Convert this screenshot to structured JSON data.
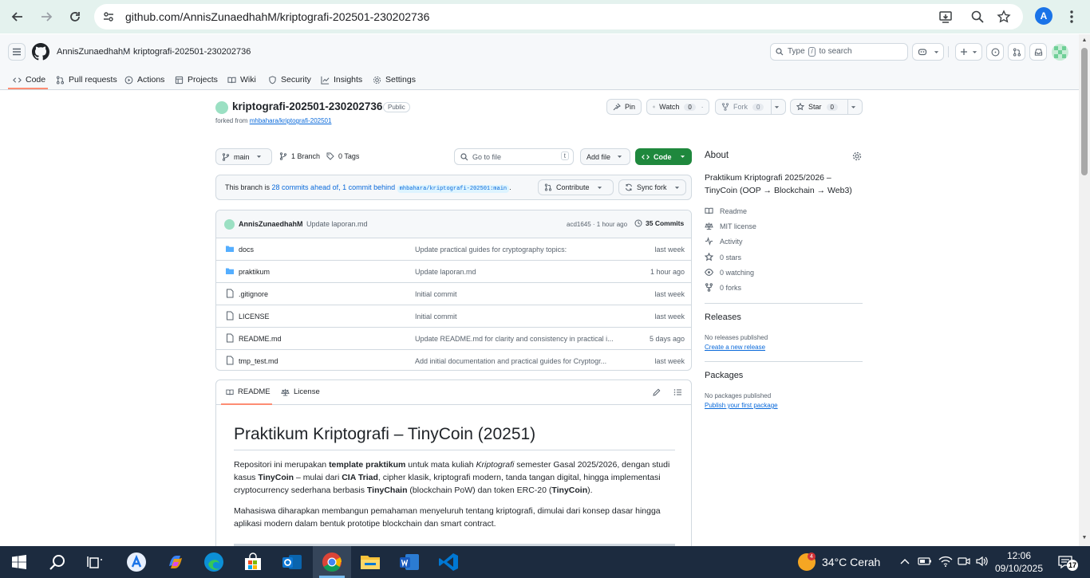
{
  "browser": {
    "url": "github.com/AnnisZunaedhahM/kriptografi-202501-230202736",
    "profile_initial": "A"
  },
  "header": {
    "owner": "AnnisZunaedhahM",
    "separator": "/",
    "repo": "kriptografi-202501-230202736",
    "search_prefix": "Type",
    "search_key": "/",
    "search_suffix": "to search"
  },
  "tabs": [
    {
      "label": "Code",
      "icon": "code-icon"
    },
    {
      "label": "Pull requests",
      "icon": "git-pull-request-icon"
    },
    {
      "label": "Actions",
      "icon": "play-circle-icon"
    },
    {
      "label": "Projects",
      "icon": "table-icon"
    },
    {
      "label": "Wiki",
      "icon": "book-icon"
    },
    {
      "label": "Security",
      "icon": "shield-icon"
    },
    {
      "label": "Insights",
      "icon": "graph-icon"
    },
    {
      "label": "Settings",
      "icon": "gear-icon"
    }
  ],
  "repo": {
    "name": "kriptografi-202501-230202736",
    "visibility": "Public",
    "forked_prefix": "forked from",
    "forked_from": "mhbahara/kriptografi-202501",
    "pin_label": "Pin",
    "watch_label": "Watch",
    "watch_count": "0",
    "fork_label": "Fork",
    "fork_count": "0",
    "star_label": "Star",
    "star_count": "0"
  },
  "branch_bar": {
    "branch": "main",
    "branches": "1 Branch",
    "tags": "0 Tags",
    "go_to_file": "Go to file",
    "go_to_file_key": "t",
    "add_file": "Add file",
    "code": "Code"
  },
  "ahead_banner": {
    "prefix": "This branch is",
    "ahead": "28 commits ahead of,",
    "behind": "1 commit behind",
    "ref": "mhbahara/kriptografi-202501:main",
    "suffix": ".",
    "contribute": "Contribute",
    "sync_fork": "Sync fork"
  },
  "latest_commit": {
    "author": "AnnisZunaedhahM",
    "message": "Update laporan.md",
    "hash_time": "acd1645 · 1 hour ago",
    "commits": "35 Commits"
  },
  "files": [
    {
      "name": "docs",
      "type": "folder",
      "message": "Update practical guides for cryptography topics:",
      "date": "last week"
    },
    {
      "name": "praktikum",
      "type": "folder",
      "message": "Update laporan.md",
      "date": "1 hour ago"
    },
    {
      "name": ".gitignore",
      "type": "file",
      "message": "Initial commit",
      "date": "last week"
    },
    {
      "name": "LICENSE",
      "type": "file",
      "message": "Initial commit",
      "date": "last week"
    },
    {
      "name": "README.md",
      "type": "file",
      "message": "Update README.md for clarity and consistency in practical i...",
      "date": "5 days ago"
    },
    {
      "name": "tmp_test.md",
      "type": "file",
      "message": "Add initial documentation and practical guides for Cryptogr...",
      "date": "last week"
    }
  ],
  "readme": {
    "tab_readme": "README",
    "tab_license": "License",
    "title": "Praktikum Kriptografi – TinyCoin (20251)",
    "p1": {
      "t1": "Repositori ini merupakan ",
      "b1": "template praktikum",
      "t2": " untuk mata kuliah ",
      "i1": "Kriptografi",
      "t3": " semester Gasal 2025/2026, dengan studi kasus ",
      "b2": "TinyCoin",
      "t4": " – mulai dari ",
      "b3": "CIA Triad",
      "t5": ", cipher klasik, kriptografi modern, tanda tangan digital, hingga implementasi cryptocurrency sederhana berbasis ",
      "b4": "TinyChain",
      "t6": " (blockchain PoW) dan token ERC-20 (",
      "b5": "TinyCoin",
      "t7": ")."
    },
    "p2": "Mahasiswa diharapkan membangun pemahaman menyeluruh tentang kriptografi, dimulai dari konsep dasar hingga aplikasi modern dalam bentuk prototipe blockchain dan smart contract."
  },
  "about": {
    "title": "About",
    "description": "Praktikum Kriptografi 2025/2026 – TinyCoin (OOP → Blockchain → Web3)",
    "items": [
      {
        "label": "Readme",
        "icon": "book-icon"
      },
      {
        "label": "MIT license",
        "icon": "law-icon"
      },
      {
        "label": "Activity",
        "icon": "pulse-icon"
      },
      {
        "label": "0 stars",
        "icon": "star-icon"
      },
      {
        "label": "0 watching",
        "icon": "eye-icon"
      },
      {
        "label": "0 forks",
        "icon": "fork-icon"
      }
    ],
    "releases_title": "Releases",
    "releases_none": "No releases published",
    "releases_link": "Create a new release",
    "packages_title": "Packages",
    "packages_none": "No packages published",
    "packages_link": "Publish your first package"
  },
  "taskbar": {
    "weather_badge": "4",
    "weather": "34°C  Cerah",
    "time": "12:06",
    "date": "09/10/2025",
    "notifications": "17"
  }
}
